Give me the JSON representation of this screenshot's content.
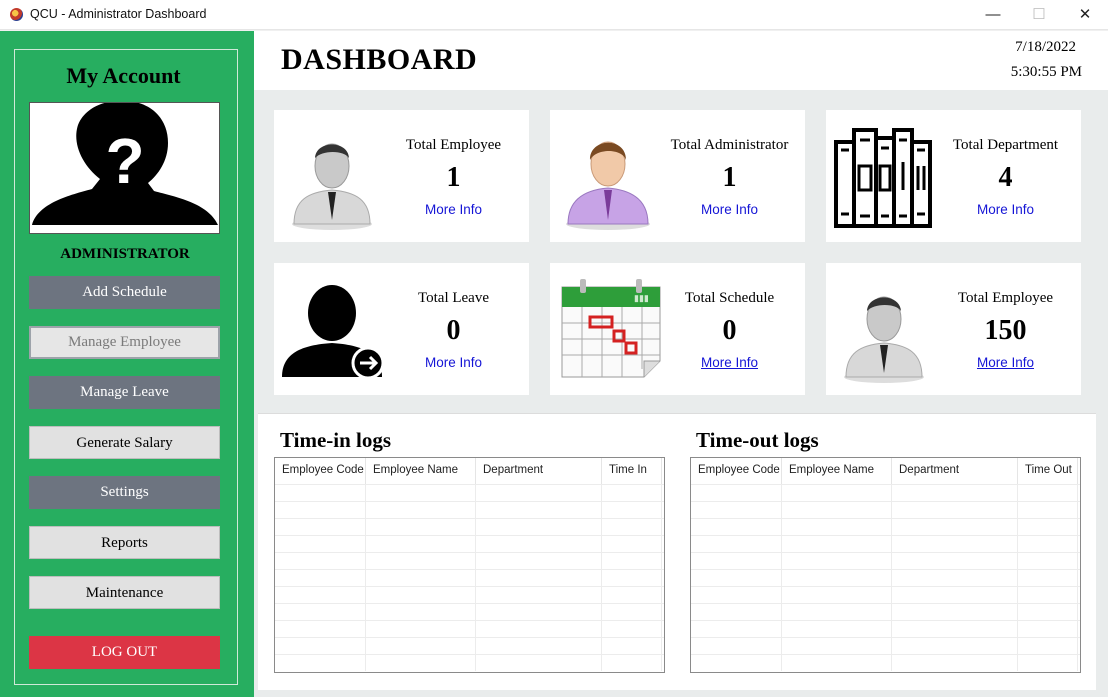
{
  "window": {
    "title": "QCU - Administrator Dashboard",
    "controls": {
      "minimize": "—",
      "maximize": "☐",
      "close": "✕"
    }
  },
  "sidebar": {
    "heading": "My Account",
    "role": "ADMINISTRATOR",
    "buttons": {
      "add_schedule": "Add Schedule",
      "manage_employee": "Manage Employee",
      "manage_leave": "Manage Leave",
      "generate_salary": "Generate Salary",
      "settings": "Settings",
      "reports": "Reports",
      "maintenance": "Maintenance",
      "logout": "LOG OUT"
    }
  },
  "header": {
    "title": "DASHBOARD",
    "date": "7/18/2022",
    "time": "5:30:55 PM"
  },
  "cards": [
    {
      "label": "Total Employee",
      "value": "1",
      "link": "More Info",
      "icon": "employee-icon"
    },
    {
      "label": "Total Administrator",
      "value": "1",
      "link": "More Info",
      "icon": "administrator-icon"
    },
    {
      "label": "Total Department",
      "value": "4",
      "link": "More Info",
      "icon": "books-icon"
    },
    {
      "label": "Total Leave",
      "value": "0",
      "link": "More Info",
      "icon": "user-leave-icon"
    },
    {
      "label": "Total Schedule",
      "value": "0",
      "link": "More Info",
      "icon": "calendar-icon"
    },
    {
      "label": "Total Employee",
      "value": "150",
      "link": "More Info",
      "icon": "employee-icon"
    }
  ],
  "logs": {
    "time_in": {
      "title": "Time-in logs",
      "columns": [
        "Employee Code",
        "Employee Name",
        "Department",
        "Time In"
      ]
    },
    "time_out": {
      "title": "Time-out logs",
      "columns": [
        "Employee Code",
        "Employee Name",
        "Department",
        "Time Out"
      ]
    }
  },
  "colors": {
    "sidebar": "#27ae60",
    "button_dark": "#6d7480",
    "logout": "#dc3545",
    "link": "#1515d6"
  }
}
